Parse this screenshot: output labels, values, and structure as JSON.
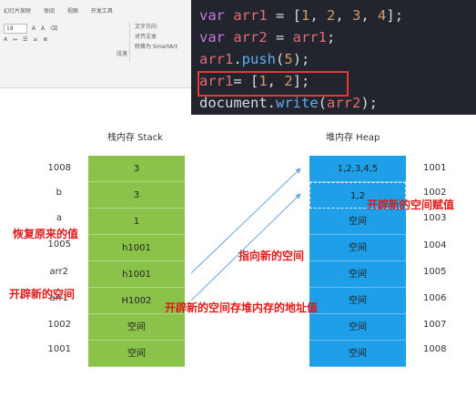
{
  "ribbon": {
    "tabs": [
      "幻灯片放映",
      "审阅",
      "视图",
      "开发工具"
    ],
    "font_size": "18",
    "tools": [
      "A",
      "A",
      "A"
    ],
    "small_items": [
      "文字方向",
      "对齐文本",
      "转换为 SmartArt"
    ],
    "group_label": "段落"
  },
  "code": {
    "lines": [
      {
        "kw": "var",
        "rest": " arr1 = [1, 2, 3, 4];"
      },
      {
        "kw": "var",
        "rest": " arr2 = arr1;"
      },
      {
        "text": "arr1.push(5);"
      },
      {
        "text": "arr1= [1, 2];"
      },
      {
        "text": "document.write(arr2);"
      }
    ]
  },
  "diagram": {
    "stack_title": "栈内存 Stack",
    "heap_title": "堆内存 Heap",
    "stack_labels": [
      "1008",
      "b",
      "a",
      "1005",
      "arr2",
      "arr1",
      "1002",
      "1001"
    ],
    "stack_cells": [
      "3",
      "3",
      "1",
      "h1001",
      "h1001",
      "H1002",
      "空间",
      "空间"
    ],
    "heap_cells": [
      "1,2,3,4,5",
      "1,2",
      "空间",
      "空间",
      "空间",
      "空间",
      "空间",
      "空间"
    ],
    "heap_addrs": [
      "1001",
      "1002",
      "1003",
      "1004",
      "1005",
      "1006",
      "1007",
      "1008"
    ],
    "annotations": {
      "restore": "恢复原来的值",
      "new_space": "开辟新的空间",
      "point_new": "指向新的空间",
      "heap_assign": "开辟新的空间赋值",
      "store_addr": "开辟新的空间存堆内存的地址值"
    }
  },
  "colors": {
    "stack": "#8bc34a",
    "heap": "#1e9fe8",
    "annotation": "#e01818",
    "highlight": "#e53935",
    "code_bg": "#23252e"
  }
}
